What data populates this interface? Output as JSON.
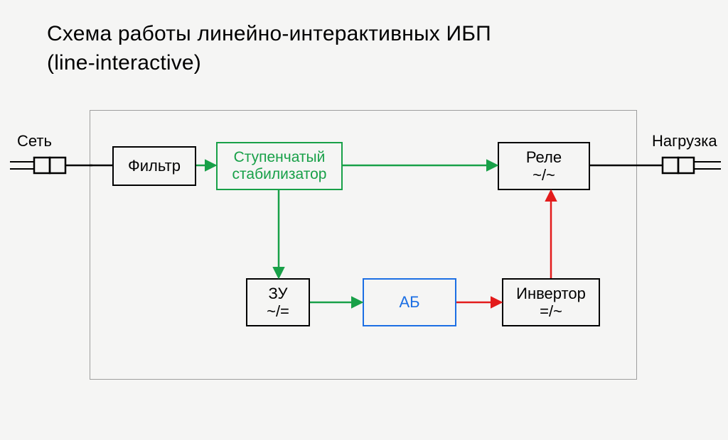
{
  "title_line1": "Схема работы линейно-интерактивных ИБП",
  "title_line2": "(line-interactive)",
  "external": {
    "input_label": "Сеть",
    "output_label": "Нагрузка"
  },
  "blocks": {
    "filter": {
      "label": "Фильтр"
    },
    "stabilizer": {
      "line1": "Ступенчатый",
      "line2": "стабилизатор"
    },
    "relay": {
      "label": "Реле",
      "sub": "~/~"
    },
    "charger": {
      "label": "ЗУ",
      "sub": "~/="
    },
    "battery": {
      "label": "АБ"
    },
    "inverter": {
      "label": "Инвертор",
      "sub": "=/~"
    }
  },
  "colors": {
    "green": "#18a048",
    "red": "#e31b1b",
    "blue": "#1c6fe4",
    "frame": "#9e9e9e"
  },
  "diagram": {
    "type": "block-diagram",
    "description": "Line-interactive UPS operating diagram",
    "nodes": [
      {
        "id": "mains",
        "label": "Сеть",
        "kind": "external"
      },
      {
        "id": "filter",
        "label": "Фильтр",
        "kind": "block",
        "border": "black"
      },
      {
        "id": "stabilizer",
        "label": "Ступенчатый стабилизатор",
        "kind": "block",
        "border": "green"
      },
      {
        "id": "relay",
        "label": "Реле ~/~",
        "kind": "block",
        "border": "black"
      },
      {
        "id": "load",
        "label": "Нагрузка",
        "kind": "external"
      },
      {
        "id": "charger",
        "label": "ЗУ ~/=",
        "kind": "block",
        "border": "black"
      },
      {
        "id": "battery",
        "label": "АБ",
        "kind": "block",
        "border": "blue"
      },
      {
        "id": "inverter",
        "label": "Инвертор =/~",
        "kind": "block",
        "border": "black"
      }
    ],
    "edges": [
      {
        "from": "mains",
        "to": "filter",
        "color": "black",
        "arrow": false
      },
      {
        "from": "filter",
        "to": "stabilizer",
        "color": "green",
        "arrow": true
      },
      {
        "from": "stabilizer",
        "to": "relay",
        "color": "green",
        "arrow": true
      },
      {
        "from": "stabilizer",
        "to": "charger",
        "color": "green",
        "arrow": true
      },
      {
        "from": "charger",
        "to": "battery",
        "color": "green",
        "arrow": true
      },
      {
        "from": "battery",
        "to": "inverter",
        "color": "red",
        "arrow": true
      },
      {
        "from": "inverter",
        "to": "relay",
        "color": "red",
        "arrow": true
      },
      {
        "from": "relay",
        "to": "load",
        "color": "black",
        "arrow": false
      }
    ]
  }
}
